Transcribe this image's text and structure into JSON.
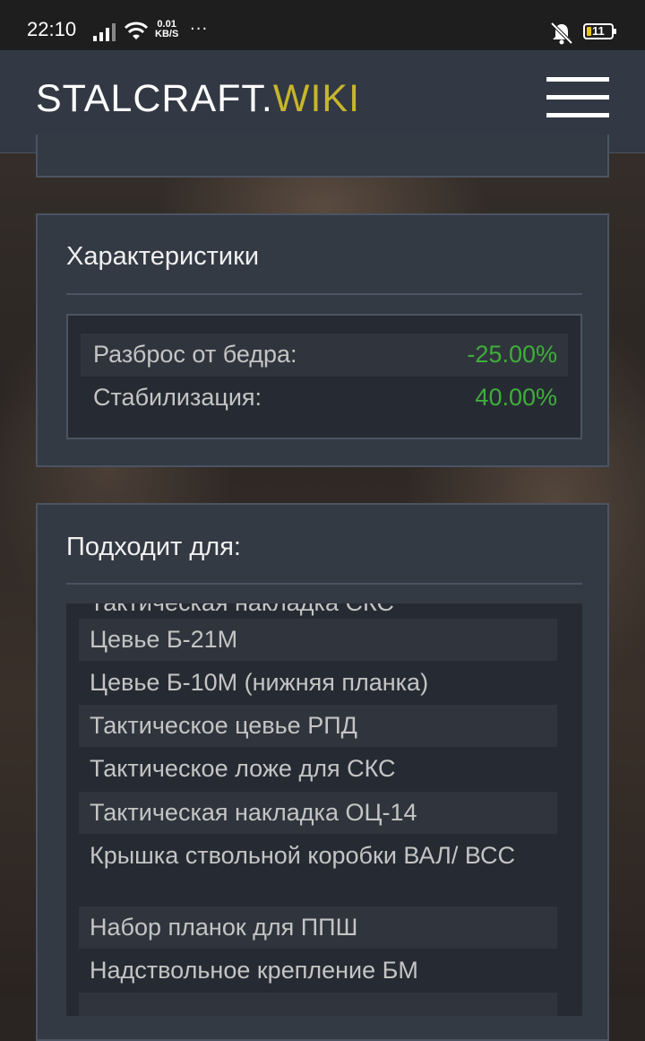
{
  "status_bar": {
    "time": "22:10",
    "net_speed_value": "0.01",
    "net_speed_unit": "KB/S",
    "more": "···",
    "battery": "11"
  },
  "header": {
    "logo_main": "STALCRAFT.",
    "logo_accent": "WIKI",
    "menu_icon": "hamburger-menu-icon"
  },
  "characteristics": {
    "title": "Характеристики",
    "rows": [
      {
        "label": "Разброс от бедра:",
        "value": "-25.00%"
      },
      {
        "label": "Стабилизация:",
        "value": "40.00%"
      }
    ]
  },
  "compatible": {
    "title": "Подходит для:",
    "partial_item": "Тактическая накладка СКС",
    "items": [
      "Цевье Б-21М",
      "Цевье Б-10М (нижняя планка)",
      "Тактическое цевье РПД",
      "Тактическое ложе для СКС",
      "Тактическая накладка ОЦ-14",
      "Крышка ствольной коробки ВАЛ/ ВСС",
      "Набор планок для ППШ",
      "Надствольное крепление БМ"
    ]
  },
  "colors": {
    "accent": "#c8b62b",
    "positive": "#3fae3a",
    "panel": "#333a44"
  }
}
